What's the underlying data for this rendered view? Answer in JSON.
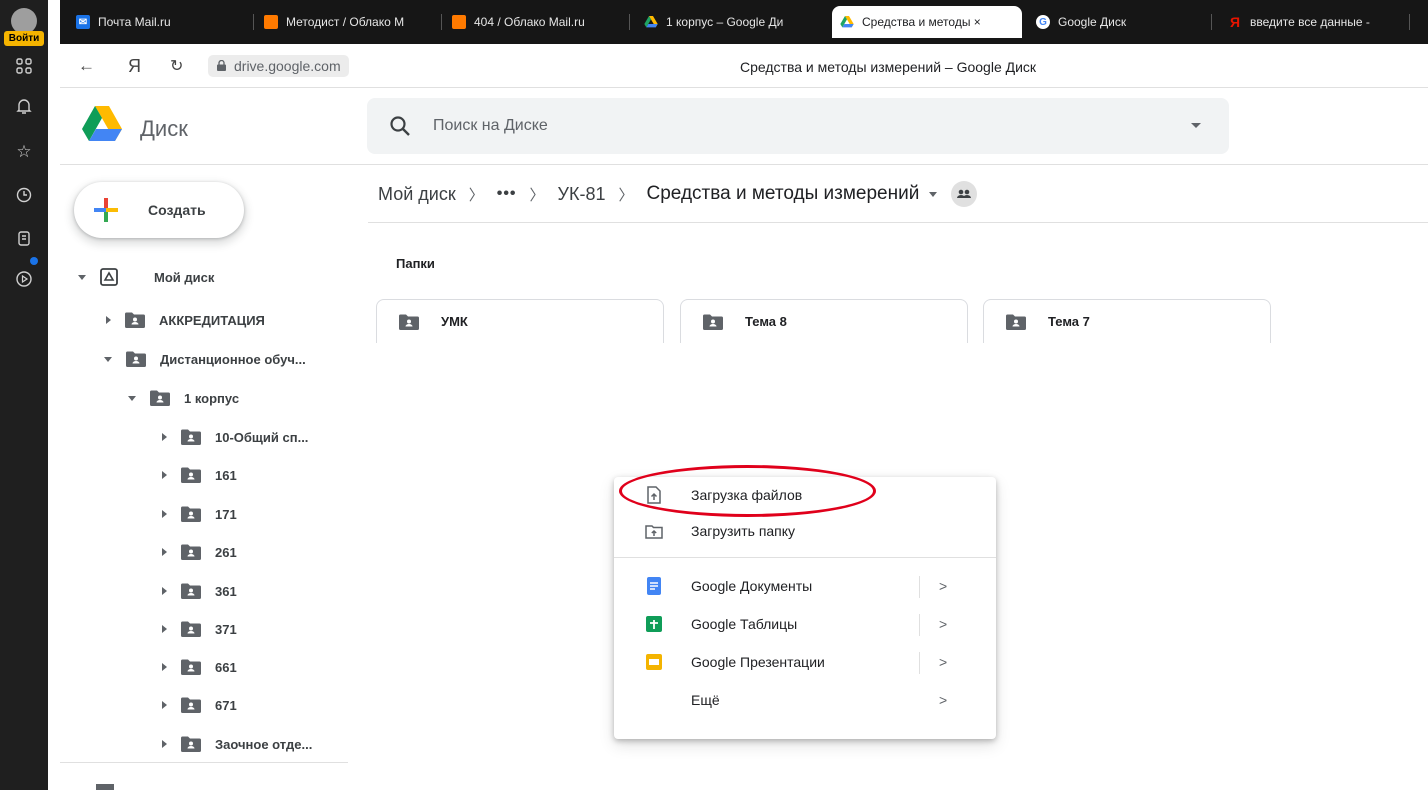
{
  "browser_sidebar": {
    "login_label": "Войти",
    "icons": [
      "apps-grid-icon",
      "bell-icon",
      "star-icon",
      "clock-icon",
      "collections-icon",
      "video-play-icon"
    ]
  },
  "tabs": [
    {
      "title": "Почта Mail.ru",
      "icon": "mail-icon",
      "color": "#1a73e8"
    },
    {
      "title": "Методист / Облако M",
      "icon": "cloud-icon",
      "color": "#ff7a00"
    },
    {
      "title": "404 / Облако Mail.ru",
      "icon": "cloud-icon",
      "color": "#ff7a00"
    },
    {
      "title": "1 корпус – Google Ди",
      "icon": "drive-icon",
      "color": "#1fa463"
    },
    {
      "title": "Средства и методы ×",
      "icon": "drive-icon",
      "color": "#1fa463"
    },
    {
      "title": "Google Диск",
      "icon": "google-icon",
      "color": "#4285f4"
    },
    {
      "title": "введите все данные -",
      "icon": "yandex-icon",
      "color": "#e61400"
    }
  ],
  "address": {
    "url": "drive.google.com",
    "page_title": "Средства и методы измерений – Google Диск"
  },
  "drive": {
    "product_name": "Диск",
    "search_placeholder": "Поиск на Диске",
    "new_button": "Создать"
  },
  "tree": {
    "root": "Мой диск",
    "items": [
      {
        "label": "АККРЕДИТАЦИЯ",
        "expanded": false
      },
      {
        "label": "Дистанционное обуч...",
        "expanded": true
      },
      {
        "label": "1 корпус",
        "expanded": true
      },
      {
        "label": "10-Общий сп...",
        "expanded": false
      },
      {
        "label": "161",
        "expanded": false
      },
      {
        "label": "171",
        "expanded": false
      },
      {
        "label": "261",
        "expanded": false
      },
      {
        "label": "361",
        "expanded": false
      },
      {
        "label": "371",
        "expanded": false
      },
      {
        "label": "661",
        "expanded": false
      },
      {
        "label": "671",
        "expanded": false
      },
      {
        "label": "Заочное отде...",
        "expanded": false
      }
    ]
  },
  "breadcrumb": {
    "root": "Мой диск",
    "ellipsis": "•••",
    "parent": "УК-81",
    "current": "Средства и методы измерений"
  },
  "content": {
    "section_label": "Папки",
    "folders": [
      "УМК",
      "Тема 8",
      "Тема 7"
    ]
  },
  "context_menu": {
    "items": [
      {
        "label": "Загрузка файлов",
        "icon": "file-upload-icon"
      },
      {
        "label": "Загрузить папку",
        "icon": "folder-upload-icon"
      },
      {
        "label": "Google Документы",
        "icon": "google-docs-icon",
        "color": "#4285f4",
        "submenu": ">"
      },
      {
        "label": "Google Таблицы",
        "icon": "google-sheets-icon",
        "color": "#0f9d58",
        "submenu": ">"
      },
      {
        "label": "Google Презентации",
        "icon": "google-slides-icon",
        "color": "#f4b400",
        "submenu": ">"
      },
      {
        "label": "Ещё",
        "icon": "",
        "submenu": ">"
      }
    ]
  },
  "annotation_color": "#e0001b"
}
